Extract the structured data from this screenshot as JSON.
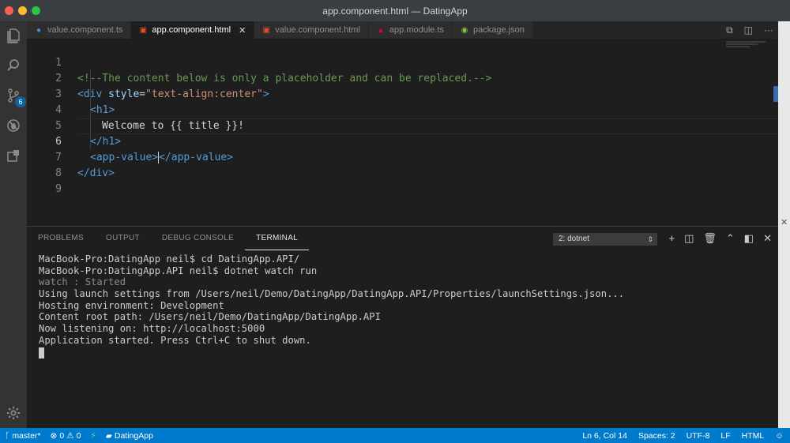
{
  "window": {
    "title": "app.component.html — DatingApp"
  },
  "activity_bar": {
    "scm_badge": "6"
  },
  "tabs": [
    {
      "label": "value.component.ts",
      "icon": "typescript-icon",
      "active": false
    },
    {
      "label": "app.component.html",
      "icon": "html5-icon",
      "active": true
    },
    {
      "label": "value.component.html",
      "icon": "html5-icon",
      "active": false
    },
    {
      "label": "app.module.ts",
      "icon": "angular-icon",
      "active": false
    },
    {
      "label": "package.json",
      "icon": "npm-icon",
      "active": false
    }
  ],
  "editor": {
    "line_numbers": [
      "1",
      "2",
      "3",
      "4",
      "5",
      "6",
      "7",
      "8",
      "9"
    ],
    "current_line": 6,
    "lines": {
      "l1": "<!--The content below is only a placeholder and can be replaced.-->",
      "l2_open": "<div",
      "l2_attr": " style",
      "l2_eq": "=",
      "l2_str": "\"text-align:center\"",
      "l2_close": ">",
      "l3": "<h1>",
      "l4": "Welcome to {{ title }}!",
      "l5": "</h1>",
      "l6_open": "<app-value>",
      "l6_close": "</app-value>",
      "l7": "</div>"
    }
  },
  "panel": {
    "tabs": [
      "PROBLEMS",
      "OUTPUT",
      "DEBUG CONSOLE",
      "TERMINAL"
    ],
    "active_tab": "TERMINAL",
    "terminal_select": "2: dotnet",
    "terminal_lines": [
      "MacBook-Pro:DatingApp neil$ cd DatingApp.API/",
      "MacBook-Pro:DatingApp.API neil$ dotnet watch run",
      "watch : Started",
      "Using launch settings from /Users/neil/Demo/DatingApp/DatingApp.API/Properties/launchSettings.json...",
      "Hosting environment: Development",
      "Content root path: /Users/neil/Demo/DatingApp/DatingApp.API",
      "Now listening on: http://localhost:5000",
      "Application started. Press Ctrl+C to shut down."
    ]
  },
  "status_bar": {
    "branch": "master*",
    "errors": "0",
    "warnings": "0",
    "project": "DatingApp",
    "position": "Ln 6, Col 14",
    "spaces": "Spaces: 2",
    "encoding": "UTF-8",
    "eol": "LF",
    "language": "HTML"
  },
  "colors": {
    "status_bar": "#007acc",
    "activity_bar": "#333333",
    "editor_bg": "#1e1e1e",
    "comment": "#6a9955",
    "tag": "#569cd6",
    "string": "#ce9178",
    "attribute": "#9cdcfe"
  }
}
